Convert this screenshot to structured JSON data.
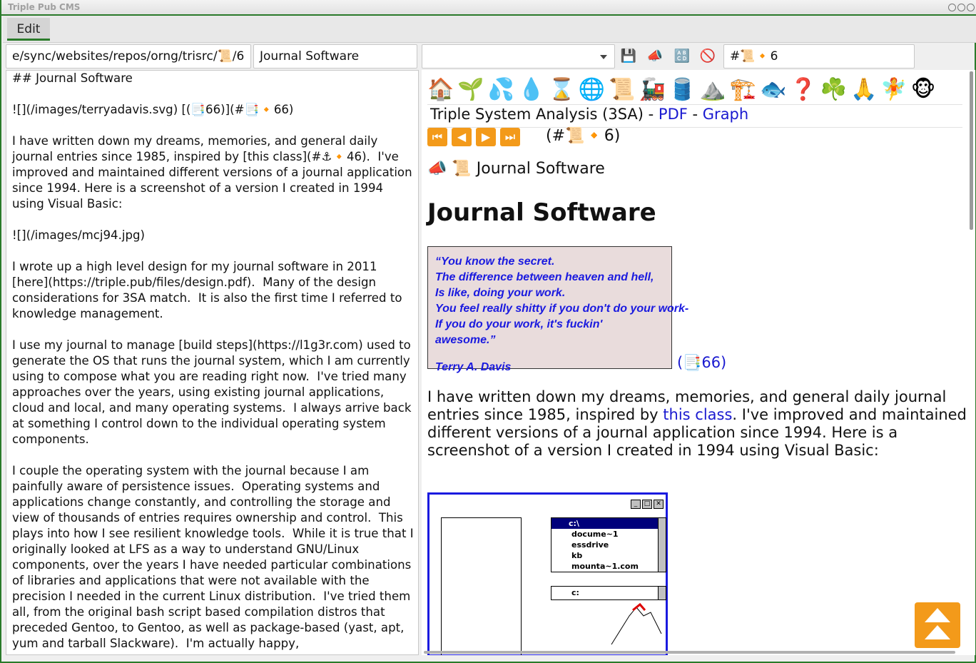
{
  "window": {
    "title": "Triple Pub CMS"
  },
  "menu": {
    "edit": "Edit"
  },
  "toolbar": {
    "path_value": "e/sync/websites/repos/orng/trisrc/📜/6",
    "title_value": "Journal Software",
    "combo_value": "",
    "save_icon": "💾",
    "announce_icon": "📣",
    "abcd_icon": "🔠",
    "cancel_icon": "🚫",
    "anchor_value": "#📜🔸6"
  },
  "editor": {
    "text": "## Journal Software\n\n![](/images/terryadavis.svg) [(📑66)](#📑🔸66)\n\nI have written down my dreams, memories, and general daily journal entries since 1985, inspired by [this class](#⚓🔸46).  I've improved and maintained different versions of a journal application since 1994. Here is a screenshot of a version I created in 1994 using Visual Basic:\n\n![](/images/mcj94.jpg)\n\nI wrote up a high level design for my journal software in 2011 [here](https://triple.pub/files/design.pdf).  Many of the design considerations for 3SA match.  It is also the first time I referred to knowledge management.\n\nI use my journal to manage [build steps](https://l1g3r.com) used to generate the OS that runs the journal system, which I am currently using to compose what you are reading right now.  I've tried many approaches over the years, using existing journal applications, cloud and local, and many operating systems.  I always arrive back at something I control down to the individual operating system components.\n\nI couple the operating system with the journal because I am painfully aware of persistence issues.  Operating systems and applications change constantly, and controlling the storage and view of thousands of entries requires ownership and control.  This plays into how I see resilient knowledge tools.  While it is true that I originally looked at LFS as a way to understand GNU/Linux components, over the years I have needed particular combinations of libraries and applications that were not available with the precision I needed in the current Linux distribution.  I've tried them all, from the original bash script based compilation distros that preceded Gentoo, to Gentoo, as well as package-based (yast, apt, yum and tarball Slackware).  I'm actually happy,"
  },
  "preview": {
    "nav_icons": [
      "🏠",
      "🌱",
      "💦",
      "💧",
      "⌛",
      "🌐",
      "📜",
      "🚂",
      "🛢️",
      "⛰️",
      "🏗️",
      "🐟",
      "❓",
      "☘️",
      "🙏",
      "🧚",
      "🐵"
    ],
    "system_title": "Triple System Analysis (3SA)",
    "dash1": " - ",
    "pdf_link": "PDF",
    "dash2": " - ",
    "graph_link": "Graph",
    "pager_ref": "(#📜🔸6)",
    "crumb": "📣 📜 Journal Software",
    "heading": "Journal Software",
    "quote_lines": [
      "“You know the secret.",
      "The difference between heaven and hell,",
      "Is like, doing your work.",
      "You feel really shitty if you don't do your work-",
      "If you do your work, it's fuckin' awesome.”"
    ],
    "quote_author": "Terry A. Davis",
    "quote_ref": "(📑66)",
    "para_before": "I have written down my dreams, memories, and general daily journal entries since 1985, inspired by ",
    "para_link": "this class",
    "para_after": ". I've improved and maintained different versions of a journal application since 1994. Here is a screenshot of a version I created in 1994 using Visual Basic:",
    "shot": {
      "dirs": [
        "c:\\",
        "docume~1",
        "essdrive",
        "kb",
        "mounta~1.com"
      ],
      "drive": "c:"
    }
  }
}
